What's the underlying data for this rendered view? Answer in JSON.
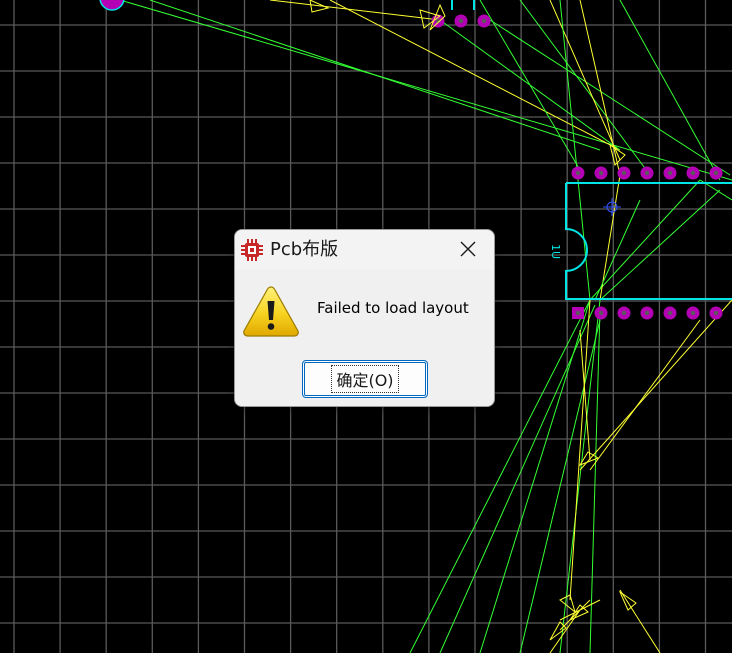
{
  "dialog": {
    "title": "Pcb布版",
    "message": "Failed to load layout",
    "ok_label": "确定(O)",
    "app_icon": "chip-icon",
    "close_icon": "close-icon",
    "status_icon": "warning-icon"
  },
  "canvas": {
    "background_color": "#000000",
    "grid_color": "#5a5a5a",
    "ratsnest_color_green": "#33ff33",
    "ratsnest_color_yellow": "#ffff33",
    "outline_color": "#00e5e5",
    "pad_color": "#b400b4",
    "component_label": "1U"
  }
}
